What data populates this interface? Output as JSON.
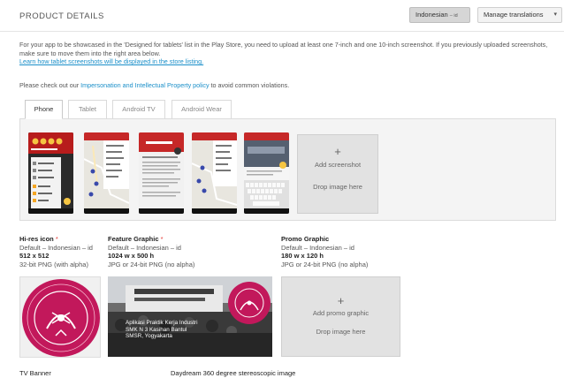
{
  "header": {
    "title": "PRODUCT DETAILS",
    "language": "Indonesian",
    "language_code": "– id",
    "manage_label": "Manage translations",
    "caret": "▾"
  },
  "intro": {
    "text": "For your app to be showcased in the 'Designed for tablets' list in the Play Store, you need to upload at least one 7-inch and one 10-inch screenshot. If you previously uploaded screenshots, make sure to move them into the right area below.",
    "link": "Learn how tablet screenshots will be displayed in the store listing."
  },
  "policy": {
    "prefix": "Please check out our ",
    "link": "Impersonation and Intellectual Property policy",
    "suffix": " to avoid common violations."
  },
  "tabs": [
    "Phone",
    "Tablet",
    "Android TV",
    "Android Wear"
  ],
  "screenshots": {
    "add_plus": "+",
    "add_label": "Add screenshot",
    "drop_label": "Drop image here"
  },
  "assets": {
    "hires": {
      "name": "Hi-res icon",
      "req": "*",
      "default": "Default – Indonesian – id",
      "size": "512 x 512",
      "format": "32-bit PNG (with alpha)"
    },
    "feature": {
      "name": "Feature Graphic",
      "req": "*",
      "default": "Default – Indonesian – id",
      "size": "1024 w x 500 h",
      "format": "JPG or 24-bit PNG (no alpha)",
      "caption": [
        "Aplikasi Praktik Kerja Industri",
        "SMK N 3 Kasihan Bantul",
        "SMSR, Yogyakarta"
      ]
    },
    "promo": {
      "name": "Promo Graphic",
      "default": "Default – Indonesian – id",
      "size": "180 w x 120 h",
      "format": "JPG or 24-bit PNG (no alpha)",
      "plus": "+",
      "add_label": "Add promo graphic",
      "drop_label": "Drop image here"
    }
  },
  "bottom": {
    "tv_banner": "TV Banner",
    "daydream": "Daydream 360 degree stereoscopic image"
  },
  "colors": {
    "link": "#1a8fc9",
    "required": "#e53935",
    "logo_magenta": "#c2185b",
    "app_red": "#b71c1c"
  }
}
